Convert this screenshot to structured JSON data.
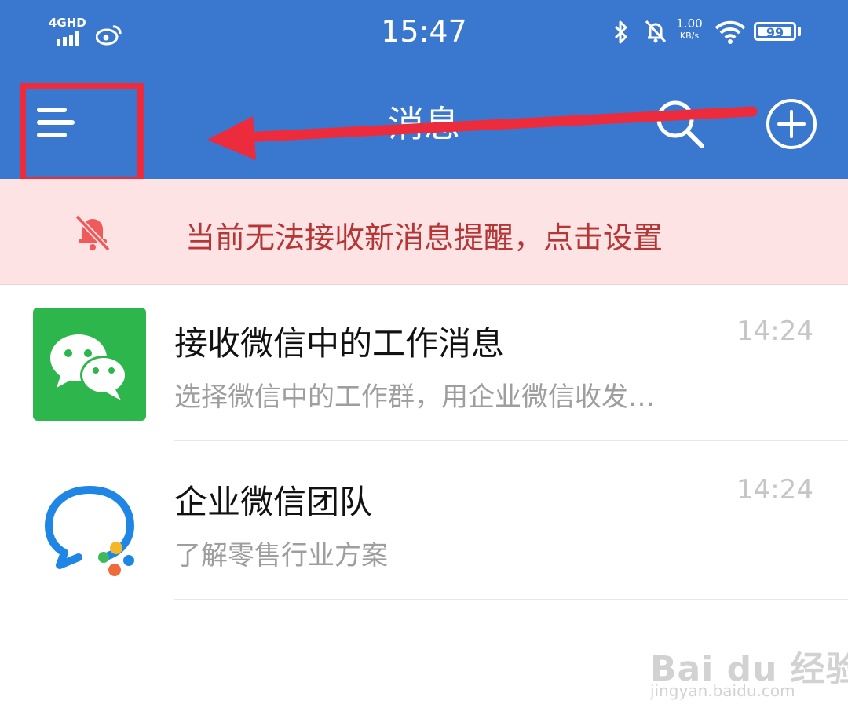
{
  "status_bar": {
    "network": "4GHD",
    "time": "15:47",
    "speed_value": "1.00",
    "speed_unit": "KB/s",
    "battery": "99"
  },
  "nav": {
    "title": "消息"
  },
  "banner": {
    "text": "当前无法接收新消息提醒，点击设置"
  },
  "messages": [
    {
      "title": "接收微信中的工作消息",
      "preview": "选择微信中的工作群，用企业微信收发…",
      "time": "14:24"
    },
    {
      "title": "企业微信团队",
      "preview": "了解零售行业方案",
      "time": "14:24"
    }
  ],
  "watermark": {
    "brand": "Bai du 经验",
    "url": "jingyan.baidu.com"
  },
  "colors": {
    "header_bg": "#3a78cf",
    "banner_bg": "#fde3e3",
    "banner_text": "#b43636",
    "annotation_red": "#ec2c3c",
    "wechat_green": "#2db64b"
  }
}
